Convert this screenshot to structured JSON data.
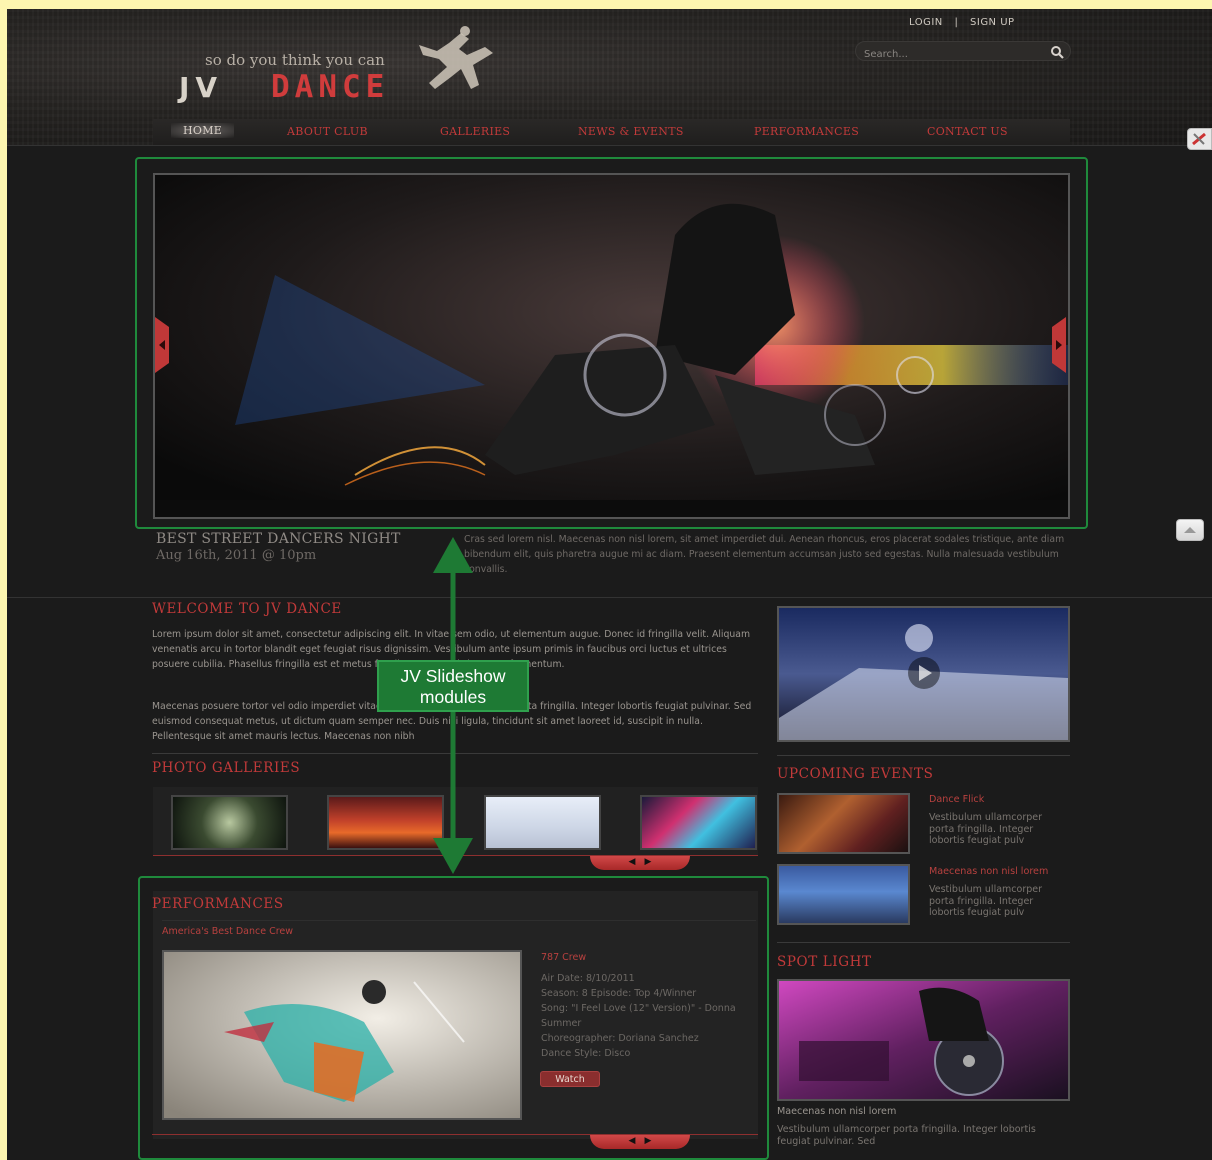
{
  "header": {
    "tagline": "so do you think you can",
    "logo_jv": "JV",
    "logo_dance": "DANCE",
    "login": "LOGIN",
    "separator": "|",
    "signup": "SIGN UP",
    "search_placeholder": "Search...",
    "nav": [
      "HOME",
      "ABOUT CLUB",
      "GALLERIES",
      "NEWS & EVENTS",
      "PERFORMANCES",
      "CONTACT US"
    ]
  },
  "slideshow": {
    "title": "BEST STREET DANCERS NIGHT",
    "date": "Aug 16th, 2011 @ 10pm",
    "text": "Cras sed lorem nisl. Maecenas non nisl lorem, sit amet imperdiet dui. Aenean rhoncus, eros placerat sodales tristique, ante diam bibendum elit, quis pharetra augue mi ac diam. Praesent elementum accumsan justo sed egestas. Nulla malesuada vestibulum convallis."
  },
  "welcome": {
    "title": "WELCOME TO JV DANCE",
    "para1": "Lorem ipsum dolor sit amet, consectetur adipiscing elit. In vitae sem odio, ut elementum augue. Donec id fringilla velit. Aliquam venenatis arcu in tortor blandit eget feugiat risus dignissim. Vestibulum ante ipsum primis in faucibus orci luctus et ultrices posuere cubilia. Phasellus fringilla est et metus faucibus eget sagittis metus fermentum.",
    "para2": "Maecenas posuere tortor vel odio imperdiet vitae hendrerit nibh ullamcorper porta fringilla. Integer lobortis feugiat pulvinar. Sed euismod consequat metus, ut dictum quam semper nec. Duis nisi ligula, tincidunt sit amet laoreet id, suscipit in nulla. Pellentesque sit amet mauris lectus. Maecenas non nibh"
  },
  "photo_galleries": {
    "title": "PHOTO GALLERIES"
  },
  "performances": {
    "title": "PERFORMANCES",
    "subtitle": "America's Best Dance Crew",
    "crew": "787 Crew",
    "air_date": "Air Date: 8/10/2011",
    "season": "Season: 8 Episode: Top 4/Winner",
    "song": "Song: \"I Feel Love (12\" Version)\" - Donna Summer",
    "choreographer": "Choreographer: Doriana Sanchez",
    "dance_style": "Dance Style: Disco",
    "watch": "Watch"
  },
  "upcoming_events": {
    "title": "UPCOMING EVENTS",
    "events": [
      {
        "title": "Dance Flick",
        "text": "Vestibulum ullamcorper porta fringilla. Integer lobortis feugiat pulv"
      },
      {
        "title": "Maecenas non nisl lorem",
        "text": "Vestibulum ullamcorper porta fringilla. Integer lobortis feugiat pulv"
      }
    ]
  },
  "spotlight": {
    "title": "SPOT LIGHT",
    "caption_title": "Maecenas non nisl lorem",
    "caption_text": "Vestibulum ullamcorper porta fringilla. Integer lobortis feugiat pulvinar. Sed"
  },
  "annotation": {
    "line1": "JV Slideshow",
    "line2": "modules"
  },
  "colors": {
    "accent": "#c23a3a",
    "annotation_green": "#1e7a34",
    "page_bg": "#1b1b1b"
  }
}
